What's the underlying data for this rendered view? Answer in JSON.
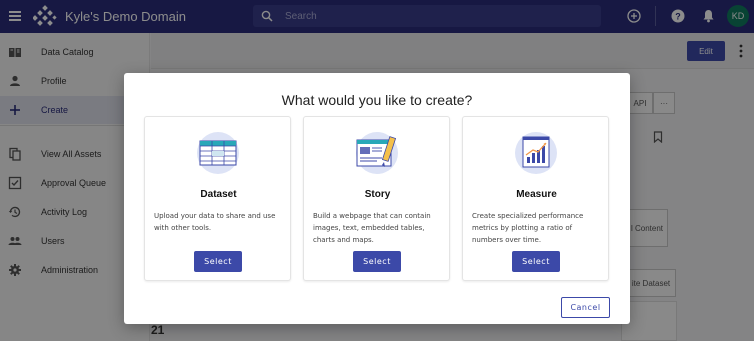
{
  "header": {
    "title": "Kyle's Demo Domain",
    "search_placeholder": "Search",
    "avatar_initials": "KD",
    "colors": {
      "bar": "#2a2d7a",
      "avatar": "#0f7b5f"
    },
    "icons": [
      "menu-icon",
      "logo-icon",
      "search-icon",
      "add-circle-icon",
      "help-icon",
      "bell-icon"
    ]
  },
  "sidebar": {
    "items": [
      {
        "label": "Data Catalog",
        "icon": "book-icon"
      },
      {
        "label": "Profile",
        "icon": "person-icon"
      },
      {
        "label": "Create",
        "icon": "plus-icon",
        "active": true
      },
      {
        "label": "View All Assets",
        "icon": "files-icon"
      },
      {
        "label": "Approval Queue",
        "icon": "checkbox-icon"
      },
      {
        "label": "Activity Log",
        "icon": "history-icon"
      },
      {
        "label": "Users",
        "icon": "people-icon"
      },
      {
        "label": "Administration",
        "icon": "gear-icon"
      }
    ]
  },
  "main": {
    "edit_label": "Edit",
    "api_label": "API",
    "more_label": "···",
    "content_btn_label": "l Content",
    "dataset_btn_label": "ite Dataset",
    "year_fragment": "21"
  },
  "modal": {
    "title": "What would you like to create?",
    "cards": [
      {
        "title": "Dataset",
        "description": "Upload your data to share and use with other tools.",
        "button": "Select",
        "icon": "table-illustration-icon"
      },
      {
        "title": "Story",
        "description": "Build a webpage that can contain images, text, embedded tables, charts and maps.",
        "button": "Select",
        "icon": "story-illustration-icon"
      },
      {
        "title": "Measure",
        "description": "Create specialized performance metrics by plotting a ratio of numbers over time.",
        "button": "Select",
        "icon": "measure-illustration-icon"
      }
    ],
    "cancel_label": "Cancel",
    "accent_color": "#3c49a8"
  }
}
